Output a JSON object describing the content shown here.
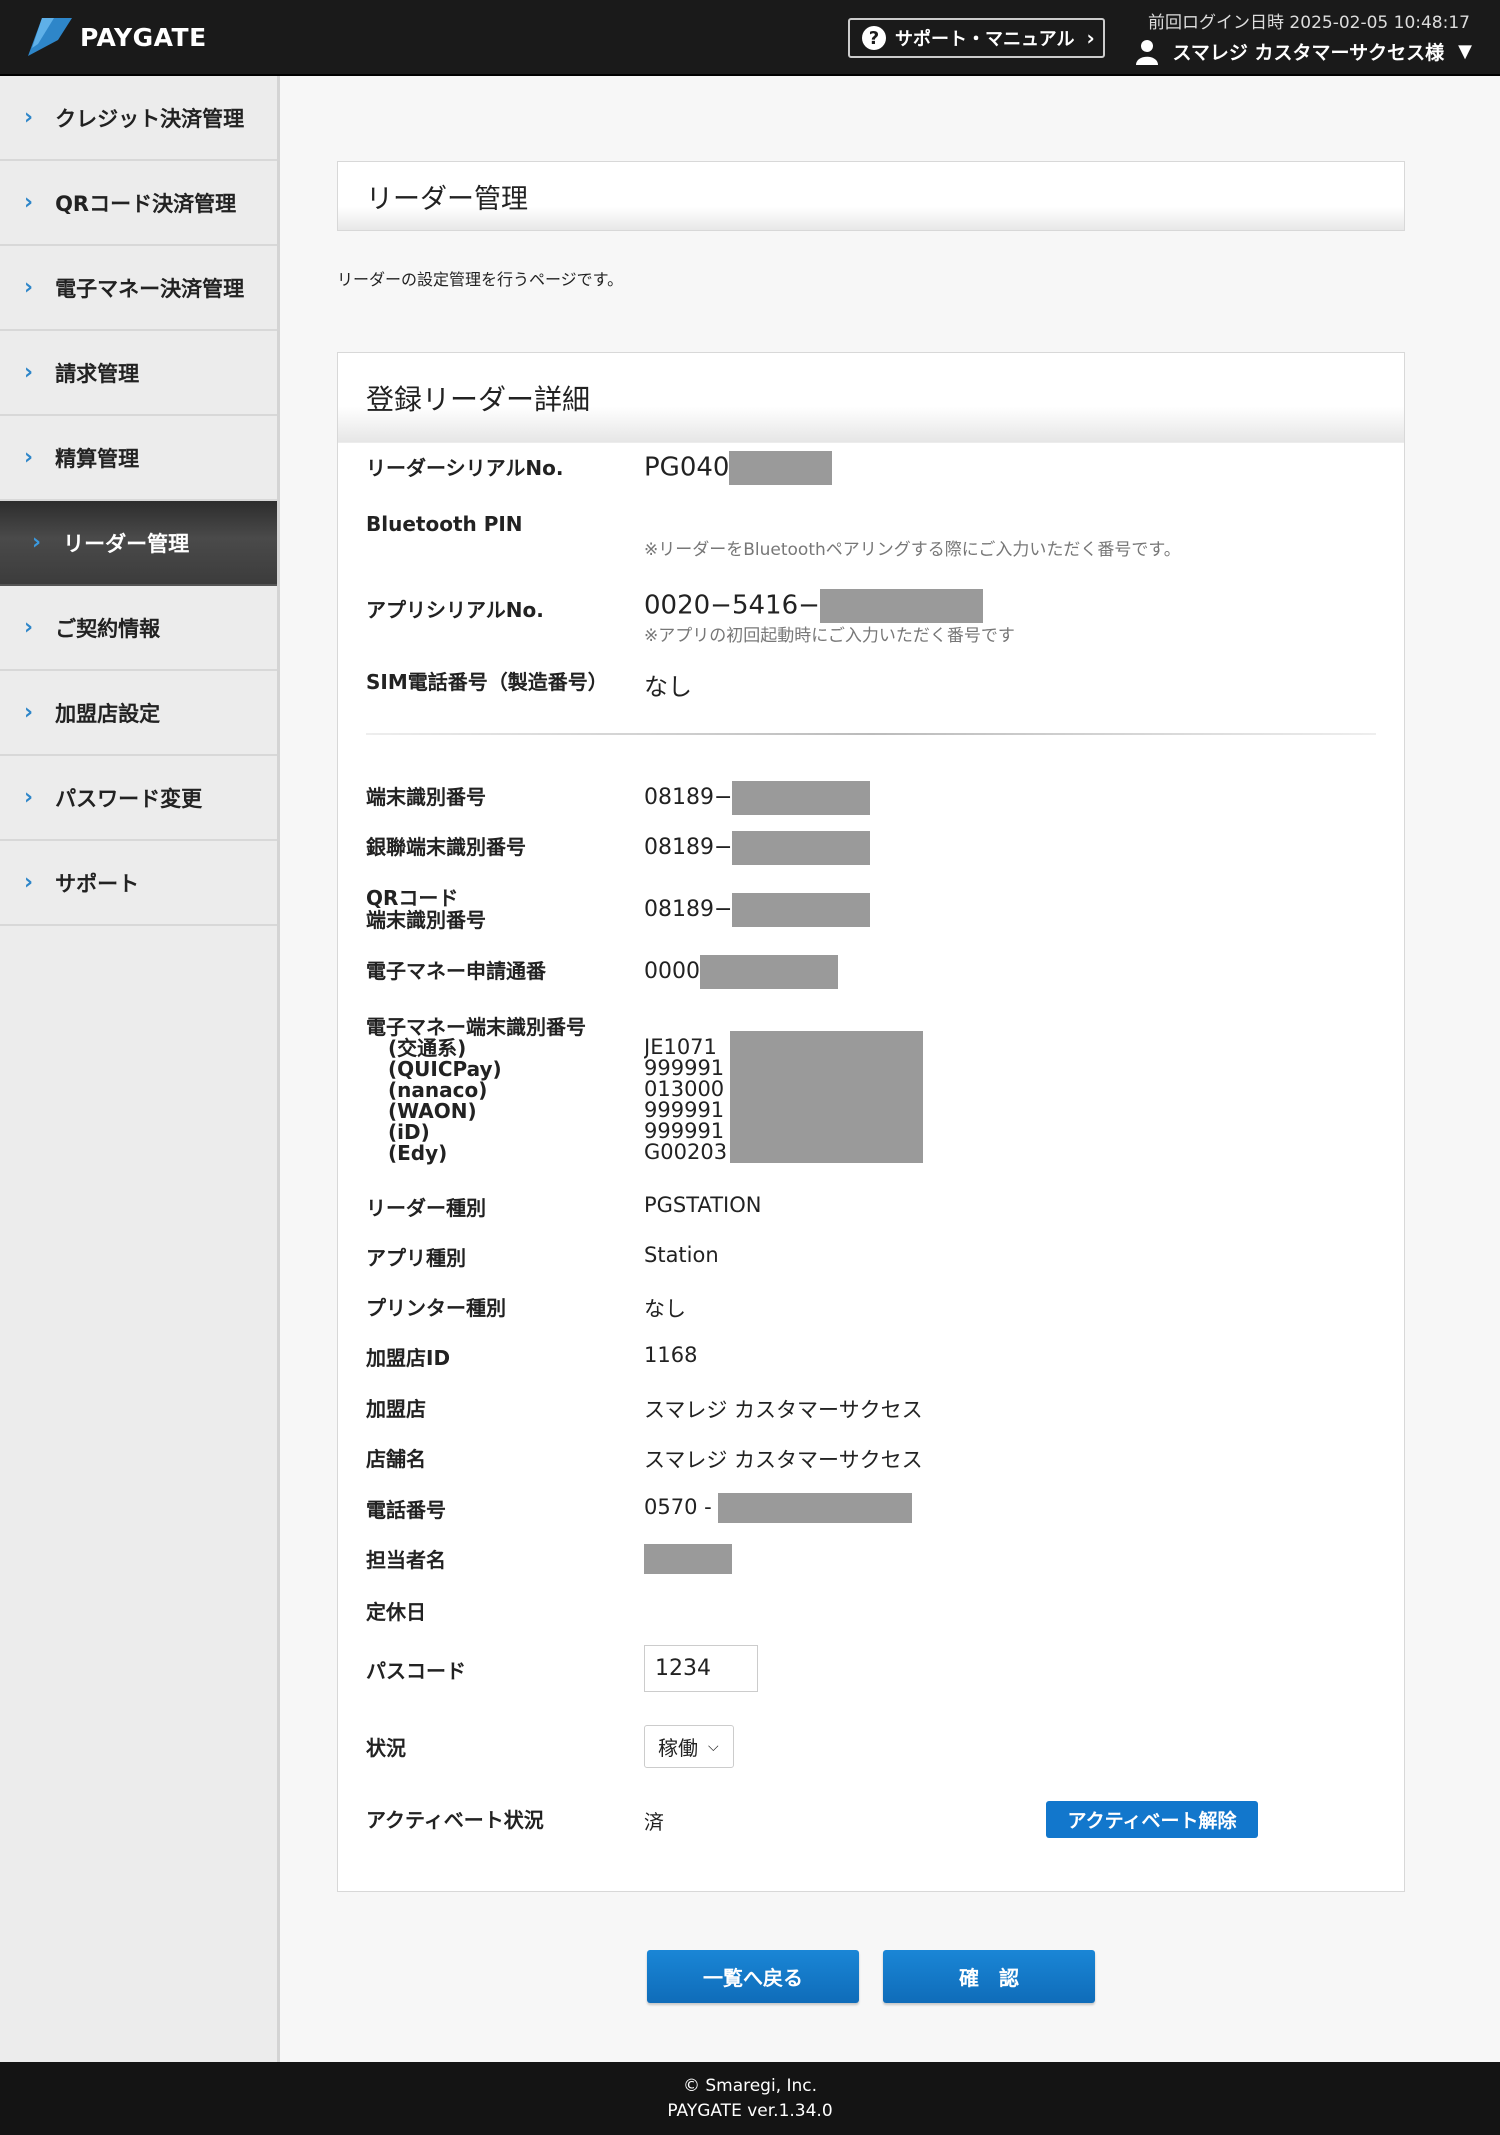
{
  "header": {
    "brand": "PAYGATE",
    "support_button": "サポート・マニュアル",
    "last_login": "前回ログイン日時 2025-02-05 10:48:17",
    "user_name": "スマレジ カスタマーサクセス様"
  },
  "sidebar": {
    "items": [
      {
        "label": "クレジット決済管理",
        "active": false
      },
      {
        "label": "QRコード決済管理",
        "active": false
      },
      {
        "label": "電子マネー決済管理",
        "active": false
      },
      {
        "label": "請求管理",
        "active": false
      },
      {
        "label": "精算管理",
        "active": false
      },
      {
        "label": "リーダー管理",
        "active": true
      },
      {
        "label": "ご契約情報",
        "active": false
      },
      {
        "label": "加盟店設定",
        "active": false
      },
      {
        "label": "パスワード変更",
        "active": false
      },
      {
        "label": "サポート",
        "active": false
      }
    ]
  },
  "page": {
    "title": "リーダー管理",
    "description": "リーダーの設定管理を行うページです。",
    "detail_title": "登録リーダー詳細"
  },
  "detail": {
    "serial_label": "リーダーシリアルNo.",
    "serial_value": "PG040",
    "bt_pin_label": "Bluetooth PIN",
    "bt_pin_note": "※リーダーをBluetoothペアリングする際にご入力いただく番号です。",
    "app_serial_label": "アプリシリアルNo.",
    "app_serial_value": "0020−5416−",
    "app_serial_note": "※アプリの初回起動時にご入力いただく番号です",
    "sim_label": "SIM電話番号（製造番号）",
    "sim_value": "なし",
    "terminal_id_label": "端末識別番号",
    "terminal_id_value": "08189−",
    "unionpay_id_label": "銀聯端末識別番号",
    "unionpay_id_value": "08189−",
    "qr_id_label_1": "QRコード",
    "qr_id_label_2": "端末識別番号",
    "qr_id_value": "08189−",
    "emoney_app_label": "電子マネー申請通番",
    "emoney_app_value": "0000",
    "emoney_terminal_label": "電子マネー端末識別番号",
    "emoney_brands": [
      {
        "name": "(交通系)",
        "value": "JE1071"
      },
      {
        "name": "(QUICPay)",
        "value": "999991"
      },
      {
        "name": "(nanaco)",
        "value": "013000"
      },
      {
        "name": "(WAON)",
        "value": "999991"
      },
      {
        "name": "(iD)",
        "value": "999991"
      },
      {
        "name": "(Edy)",
        "value": "G00203"
      }
    ],
    "reader_type_label": "リーダー種別",
    "reader_type_value": "PGSTATION",
    "app_type_label": "アプリ種別",
    "app_type_value": "Station",
    "printer_type_label": "プリンター種別",
    "printer_type_value": "なし",
    "merchant_id_label": "加盟店ID",
    "merchant_id_value": "1168",
    "merchant_label": "加盟店",
    "merchant_value": "スマレジ カスタマーサクセス",
    "store_label": "店舗名",
    "store_value": "スマレジ カスタマーサクセス",
    "phone_label": "電話番号",
    "phone_value": "0570 -",
    "staff_label": "担当者名",
    "holiday_label": "定休日",
    "passcode_label": "パスコード",
    "passcode_value": "1234",
    "status_label": "状況",
    "status_value": "稼働",
    "activation_label": "アクティベート状況",
    "activation_value": "済",
    "deactivate_button": "アクティベート解除"
  },
  "actions": {
    "back_button": "一覧へ戻る",
    "confirm_button": "確　認"
  },
  "footer": {
    "copyright": "© Smaregi, Inc.",
    "version": "PAYGATE ver.1.34.0"
  },
  "colors": {
    "header_bg": "#1a1a1a",
    "accent_blue": "#1277cc",
    "sidebar_bg": "#ececec",
    "redaction": "#9a9a9a"
  }
}
